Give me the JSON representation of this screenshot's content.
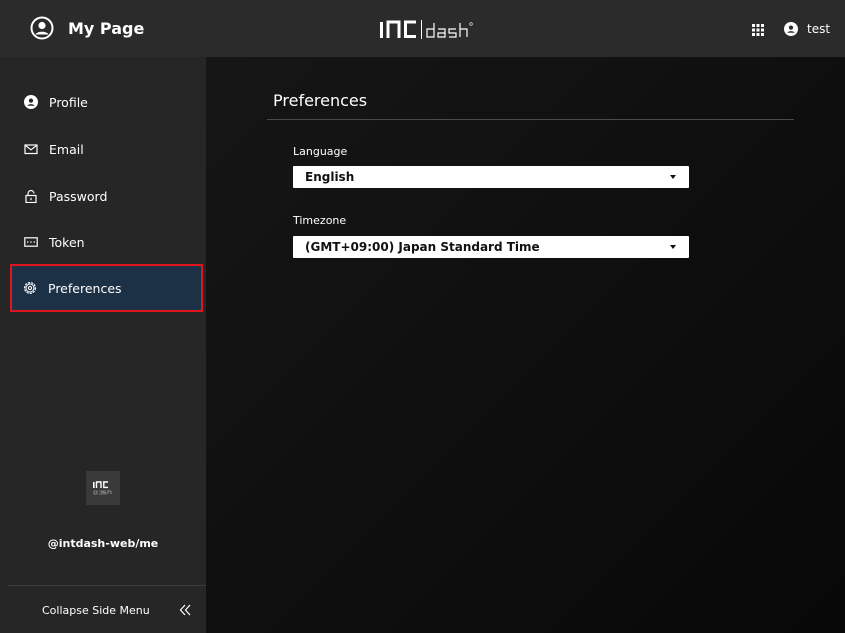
{
  "header": {
    "title": "My Page",
    "brand": "intdash",
    "user": "test"
  },
  "sidebar": {
    "items": [
      {
        "label": "Profile",
        "icon": "user-icon"
      },
      {
        "label": "Email",
        "icon": "mail-icon"
      },
      {
        "label": "Password",
        "icon": "lock-icon"
      },
      {
        "label": "Token",
        "icon": "keyboard-icon"
      },
      {
        "label": "Preferences",
        "icon": "gear-icon",
        "active": true
      }
    ],
    "handle": "@intdash-web/me",
    "collapse_label": "Collapse Side Menu"
  },
  "main": {
    "title": "Preferences",
    "language": {
      "label": "Language",
      "value": "English"
    },
    "timezone": {
      "label": "Timezone",
      "value": "(GMT+09:00) Japan Standard Time"
    }
  },
  "colors": {
    "header_bg": "#2b2b2b",
    "sidebar_bg": "#262626",
    "active_bg": "#1c3046",
    "highlight_border": "#e0151b"
  }
}
